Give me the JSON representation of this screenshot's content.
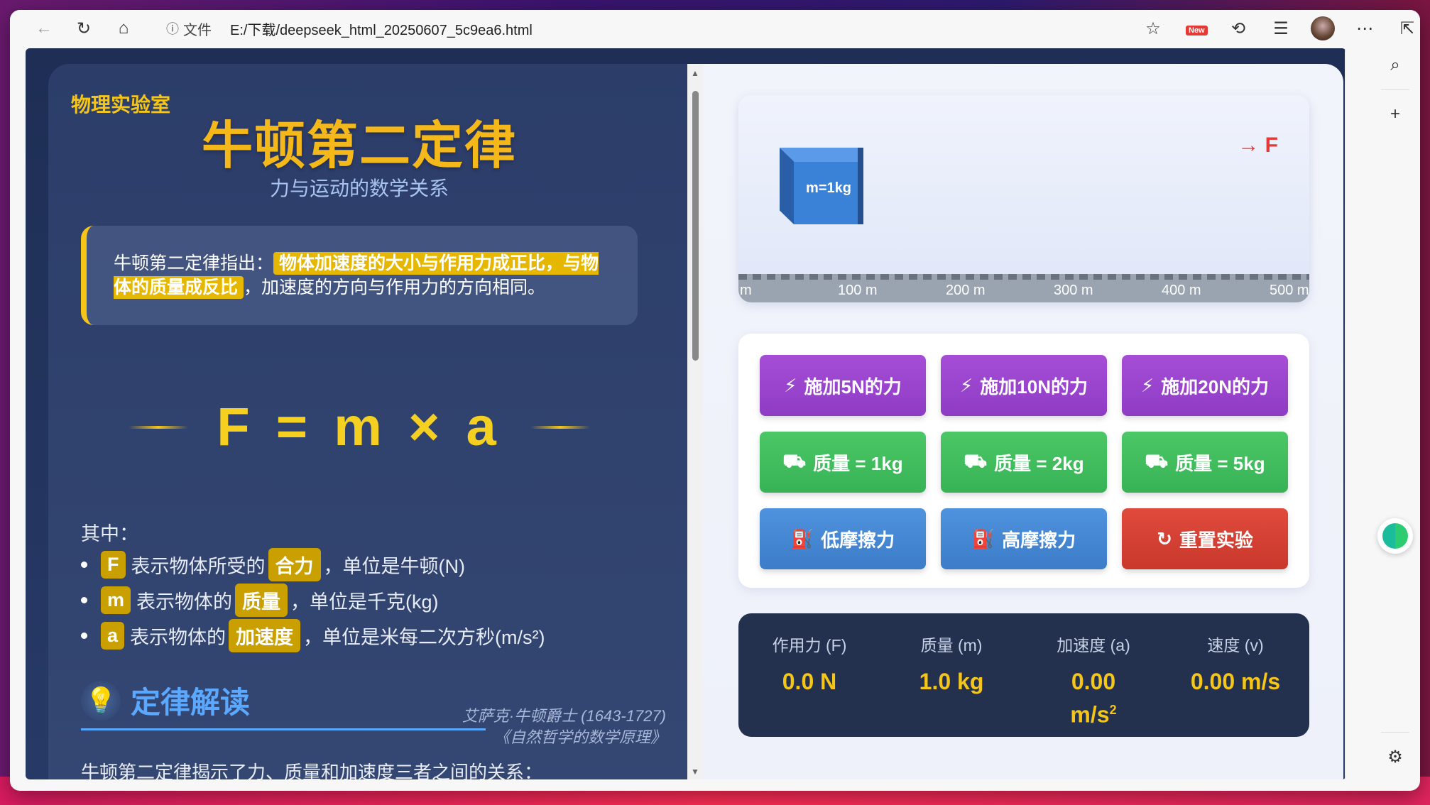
{
  "browser": {
    "file_label": "文件",
    "url": "E:/下载/deepseek_html_20250607_5c9ea6.html",
    "new_badge": "New"
  },
  "left": {
    "lab_tag": "物理实验室",
    "title": "牛顿第二定律",
    "subtitle": "力与运动的数学关系",
    "law_prefix": "牛顿第二定律指出：",
    "law_highlight": "物体加速度的大小与作用力成正比，与物体的质量成反比",
    "law_suffix": "，加速度的方向与作用力的方向相同。",
    "formula": "F = m × a",
    "where": "其中：",
    "defs": [
      {
        "sym": "F",
        "pre": "表示物体所受的",
        "key": "合力",
        "post": "，单位是牛顿(N)"
      },
      {
        "sym": "m",
        "pre": "表示物体的",
        "key": "质量",
        "post": "，单位是千克(kg)"
      },
      {
        "sym": "a",
        "pre": "表示物体的",
        "key": "加速度",
        "post": "，单位是米每二次方秒(m/s²)"
      }
    ],
    "interp_title": "定律解读",
    "quote_line1": "艾萨克·牛顿爵士 (1643-1727)",
    "quote_line2": "《自然哲学的数学原理》",
    "cutoff": "牛顿第二定律揭示了力、质量和加速度三者之间的关系："
  },
  "sim": {
    "mass_label": "m=1kg",
    "force_label": "→ F",
    "ruler": [
      "m",
      "100 m",
      "200 m",
      "300 m",
      "400 m",
      "500 m"
    ]
  },
  "buttons": {
    "f5": "施加5N的力",
    "f10": "施加10N的力",
    "f20": "施加20N的力",
    "m1": "质量 = 1kg",
    "m2": "质量 = 2kg",
    "m5": "质量 = 5kg",
    "low": "低摩擦力",
    "high": "高摩擦力",
    "reset": "重置实验"
  },
  "readout": {
    "force_label": "作用力 (F)",
    "force_value": "0.0 N",
    "mass_label": "质量 (m)",
    "mass_value": "1.0 kg",
    "acc_label": "加速度 (a)",
    "acc_value": "0.00",
    "acc_unit": "m/s",
    "vel_label": "速度 (v)",
    "vel_value": "0.00 m/s"
  },
  "icons": {
    "bolt": "lightning-icon",
    "weight": "weight-icon",
    "oil": "oil-can-icon",
    "reset": "redo-icon"
  }
}
